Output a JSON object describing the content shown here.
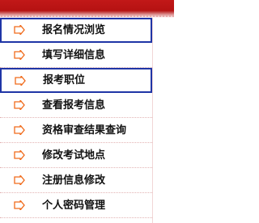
{
  "menu": {
    "items": [
      {
        "label": "报名情况浏览",
        "icon": "arrow-right-icon",
        "highlight": true
      },
      {
        "label": "填写详细信息",
        "icon": "arrow-right-icon"
      },
      {
        "label": "报考职位",
        "icon": "arrow-right-icon",
        "highlight": true,
        "focused": true
      },
      {
        "label": "查看报考信息",
        "icon": "arrow-right-icon"
      },
      {
        "label": "资格审查结果查询",
        "icon": "arrow-right-icon"
      },
      {
        "label": "修改考试地点",
        "icon": "arrow-right-icon"
      },
      {
        "label": "注册信息修改",
        "icon": "arrow-right-icon"
      },
      {
        "label": "个人密码管理",
        "icon": "arrow-right-icon"
      }
    ]
  },
  "colors": {
    "header_red": "#c21818",
    "icon_orange": "#f06a1a",
    "highlight_blue": "#1f35a6"
  }
}
